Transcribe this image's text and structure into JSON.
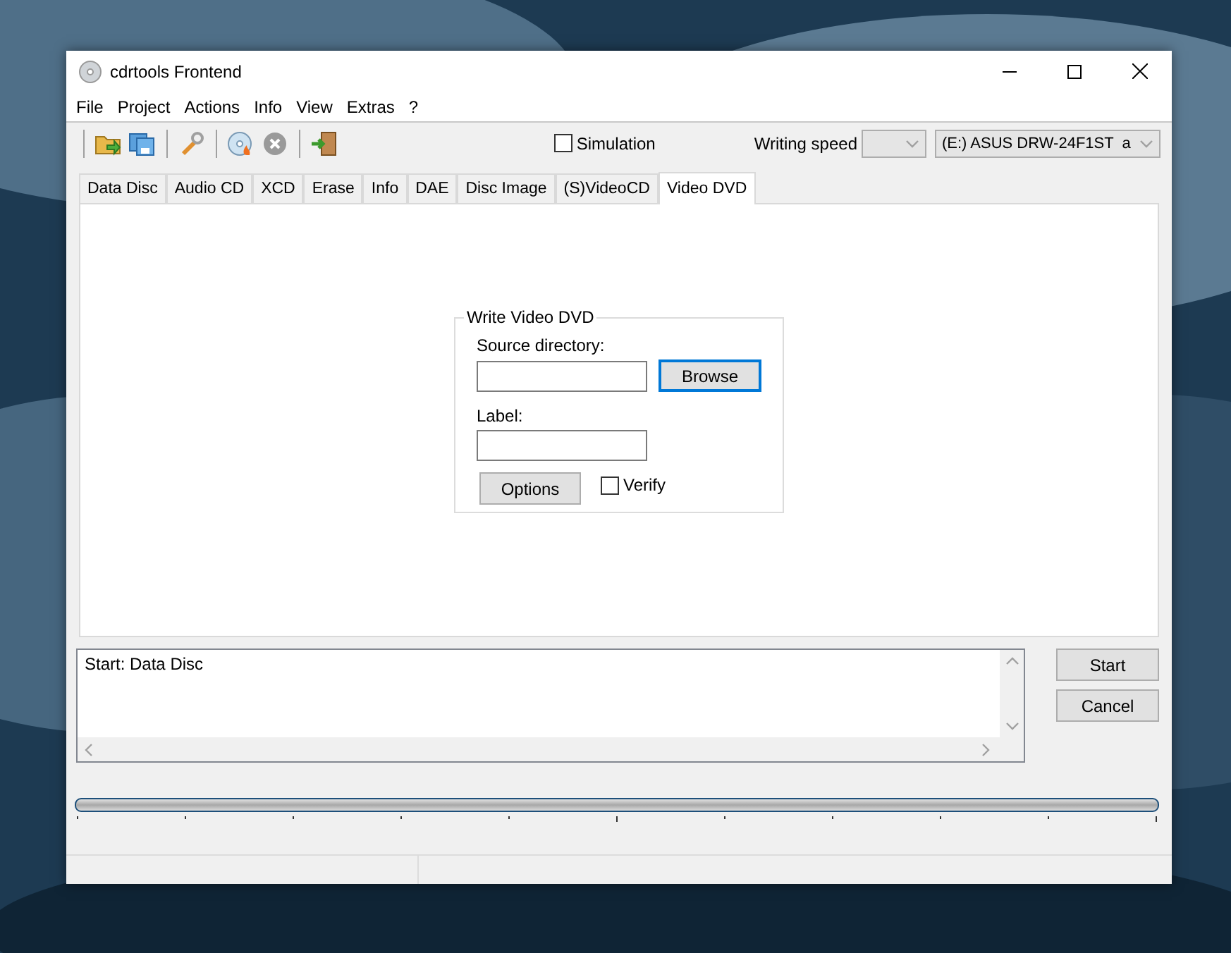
{
  "window": {
    "title": "cdrtools Frontend"
  },
  "menu": [
    "File",
    "Project",
    "Actions",
    "Info",
    "View",
    "Extras",
    "?"
  ],
  "toolbar": {
    "simulation": {
      "label": "Simulation",
      "checked": false
    },
    "speed_label": "Writing speed",
    "drive": "(E:) ASUS DRW-24F1ST  a"
  },
  "tabs": [
    {
      "label": "Data Disc",
      "selected": false
    },
    {
      "label": "Audio CD",
      "selected": false
    },
    {
      "label": "XCD",
      "selected": false
    },
    {
      "label": "Erase",
      "selected": false
    },
    {
      "label": "Info",
      "selected": false
    },
    {
      "label": "DAE",
      "selected": false
    },
    {
      "label": "Disc Image",
      "selected": false
    },
    {
      "label": "(S)VideoCD",
      "selected": false
    },
    {
      "label": "Video DVD",
      "selected": true
    }
  ],
  "group": {
    "title": "Write Video DVD",
    "source_label": "Source directory:",
    "browse": {
      "label": "Browse",
      "focused": true
    },
    "label_label": "Label:",
    "options": "Options",
    "verify": {
      "label": "Verify",
      "checked": false
    }
  },
  "log": [
    "Start: Data Disc"
  ],
  "buttons": [
    "Start",
    "Cancel"
  ]
}
